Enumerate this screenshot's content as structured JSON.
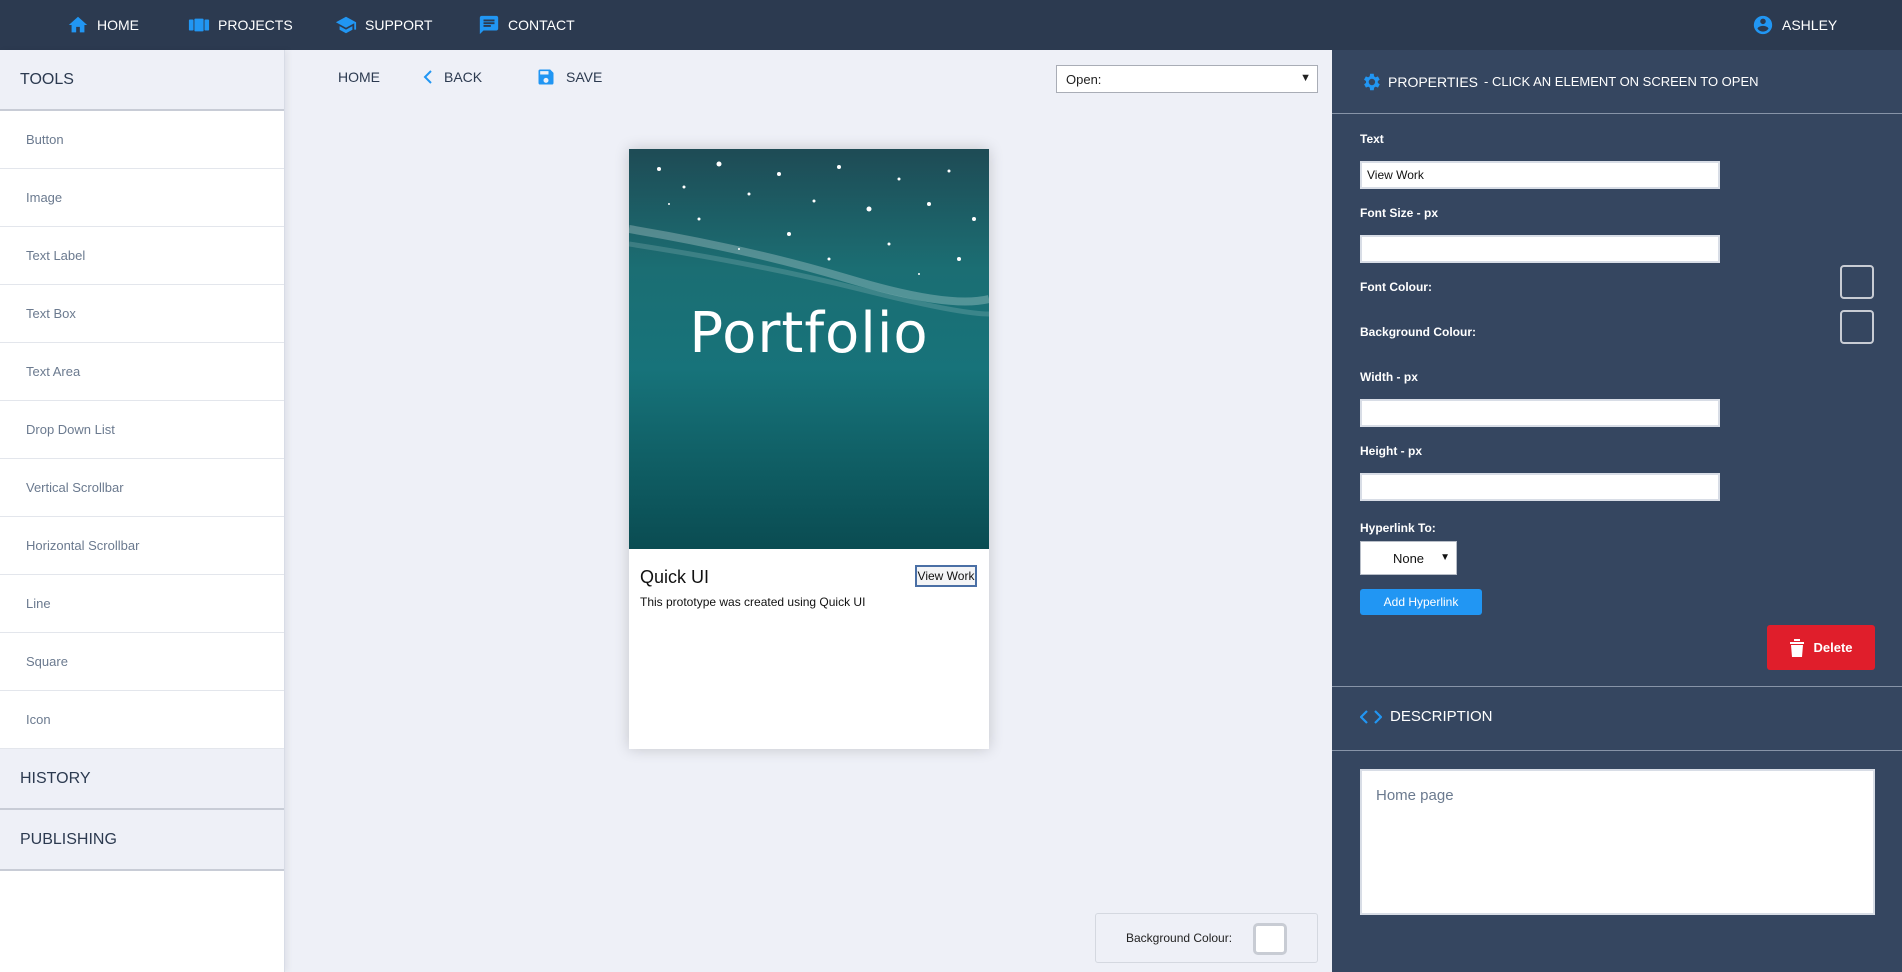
{
  "nav": {
    "home": "HOME",
    "projects": "PROJECTS",
    "support": "SUPPORT",
    "contact": "CONTACT",
    "user": "ASHLEY"
  },
  "sidebar": {
    "tools_header": "TOOLS",
    "items": [
      {
        "label": "Button"
      },
      {
        "label": "Image"
      },
      {
        "label": "Text Label"
      },
      {
        "label": "Text Box"
      },
      {
        "label": "Text Area"
      },
      {
        "label": "Drop Down List"
      },
      {
        "label": "Vertical Scrollbar"
      },
      {
        "label": "Horizontal Scrollbar"
      },
      {
        "label": "Line"
      },
      {
        "label": "Square"
      },
      {
        "label": "Icon"
      }
    ],
    "history_header": "HISTORY",
    "publishing_header": "PUBLISHING"
  },
  "toolbar": {
    "home": "HOME",
    "back": "BACK",
    "save": "SAVE",
    "open_select": "Open:"
  },
  "preview": {
    "hero_title": "Portfolio",
    "card_title": "Quick UI",
    "card_desc": "This prototype was created using Quick UI",
    "button_label": "View Work"
  },
  "canvas": {
    "background_colour_label": "Background Colour:"
  },
  "properties": {
    "title": "PROPERTIES",
    "subtitle": "- CLICK AN ELEMENT ON SCREEN TO OPEN",
    "text_label": "Text",
    "text_value": "View Work",
    "font_size_label": "Font Size - px",
    "font_size_value": "",
    "font_colour_label": "Font Colour:",
    "background_colour_label": "Background Colour:",
    "width_label": "Width - px",
    "width_value": "",
    "height_label": "Height - px",
    "height_value": "",
    "hyperlink_label": "Hyperlink To:",
    "hyperlink_value": "None",
    "add_hyperlink": "Add Hyperlink",
    "delete": "Delete"
  },
  "description": {
    "title": "DESCRIPTION",
    "value": "Home page"
  },
  "colors": {
    "topnav": "#2c3a50",
    "panel": "#354660",
    "accent": "#2196f3",
    "delete": "#e01e2b",
    "canvas": "#eef0f7"
  }
}
